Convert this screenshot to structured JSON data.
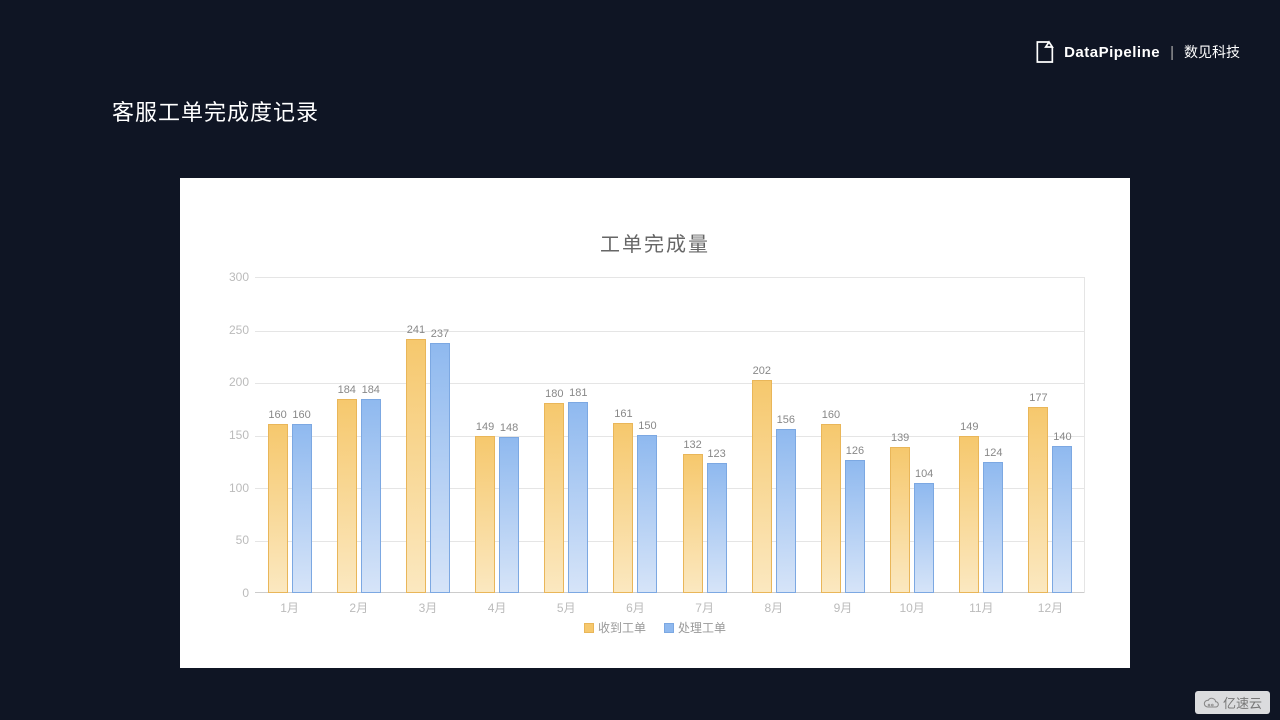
{
  "brand": {
    "name": "DataPipeline",
    "cn": "数见科技",
    "sep": "|"
  },
  "page_title": "客服工单完成度记录",
  "watermark": "亿速云",
  "chart_data": {
    "type": "bar",
    "title": "工单完成量",
    "xlabel": "",
    "ylabel": "",
    "ylim": [
      0,
      300
    ],
    "yticks": [
      0,
      50,
      100,
      150,
      200,
      250,
      300
    ],
    "categories": [
      "1月",
      "2月",
      "3月",
      "4月",
      "5月",
      "6月",
      "7月",
      "8月",
      "9月",
      "10月",
      "11月",
      "12月"
    ],
    "series": [
      {
        "name": "收到工单",
        "values": [
          160,
          184,
          241,
          149,
          180,
          161,
          132,
          202,
          160,
          139,
          149,
          177
        ]
      },
      {
        "name": "处理工单",
        "values": [
          160,
          184,
          237,
          148,
          181,
          150,
          123,
          156,
          126,
          104,
          124,
          140
        ]
      }
    ],
    "legend_position": "bottom",
    "grid": true
  }
}
